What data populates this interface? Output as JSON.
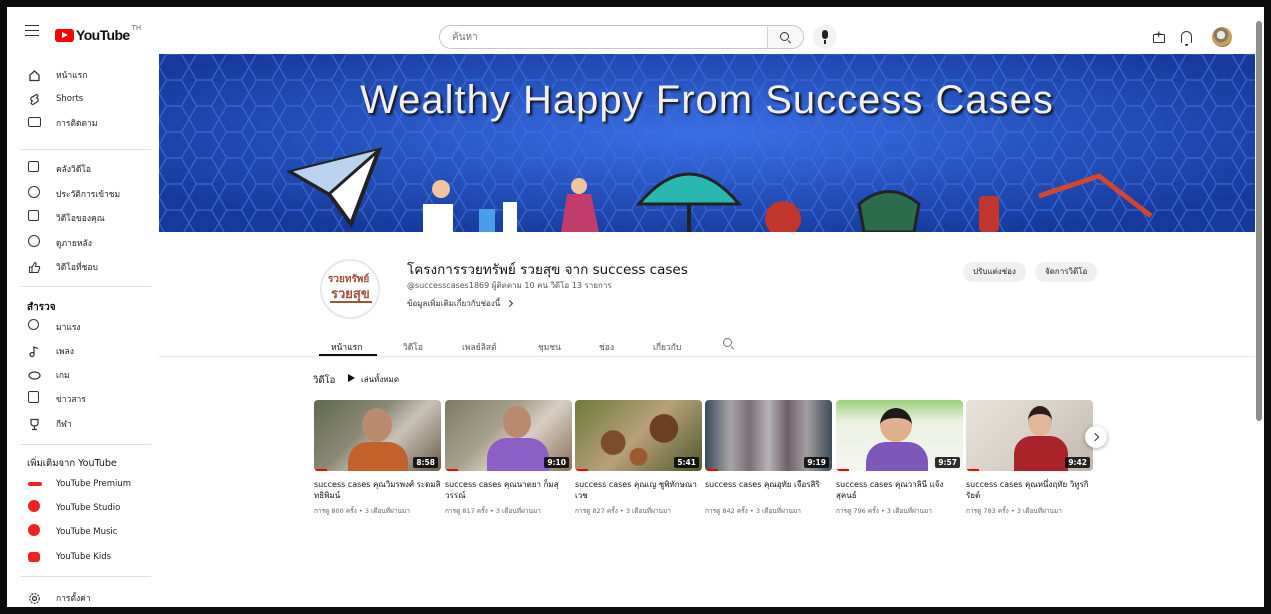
{
  "header": {
    "logo_text": "YouTube",
    "country_code": "TH",
    "search_placeholder": "ค้นหา",
    "icons": [
      "menu-icon",
      "search-icon",
      "mic-icon",
      "create-icon",
      "bell-icon",
      "avatar"
    ]
  },
  "sidebar": {
    "main": [
      {
        "label": "หน้าแรก",
        "icon": "home-icon"
      },
      {
        "label": "Shorts",
        "icon": "shorts-icon"
      },
      {
        "label": "การติดตาม",
        "icon": "subscriptions-icon"
      }
    ],
    "library": [
      {
        "label": "คลังวิดีโอ",
        "icon": "library-icon"
      },
      {
        "label": "ประวัติการเข้าชม",
        "icon": "history-icon"
      },
      {
        "label": "วิดีโอของคุณ",
        "icon": "your-videos-icon"
      },
      {
        "label": "ดูภายหลัง",
        "icon": "watch-later-icon"
      },
      {
        "label": "วิดีโอที่ชอบ",
        "icon": "liked-icon"
      }
    ],
    "explore_title": "สำรวจ",
    "explore": [
      {
        "label": "มาแรง",
        "icon": "trending-icon"
      },
      {
        "label": "เพลง",
        "icon": "music-icon"
      },
      {
        "label": "เกม",
        "icon": "gaming-icon"
      },
      {
        "label": "ข่าวสาร",
        "icon": "news-icon"
      },
      {
        "label": "กีฬา",
        "icon": "sports-icon"
      }
    ],
    "more_title": "เพิ่มเติมจาก YouTube",
    "more": [
      {
        "label": "YouTube Premium",
        "icon": "youtube-premium-icon"
      },
      {
        "label": "YouTube Studio",
        "icon": "youtube-studio-icon"
      },
      {
        "label": "YouTube Music",
        "icon": "youtube-music-icon"
      },
      {
        "label": "YouTube Kids",
        "icon": "youtube-kids-icon"
      }
    ],
    "settings_label": "การตั้งค่า"
  },
  "banner": {
    "text": "Wealthy Happy From Success Cases",
    "accent": "#1f49b8"
  },
  "channel": {
    "avatar_text_1": "รวยทรัพย์",
    "avatar_text_2": "รวยสุข",
    "title": "โครงการรวยทรัพย์ รวยสุข จาก success cases",
    "handle": "@successcases1869",
    "subscribers": "ผู้ติดตาม 10 คน",
    "video_count": "วิดีโอ 13 รายการ",
    "more_info": "ข้อมูลเพิ่มเติมเกี่ยวกับช่องนี้",
    "customize_button": "ปรับแต่งช่อง",
    "manage_button": "จัดการวิดีโอ"
  },
  "tabs": [
    "หน้าแรก",
    "วิดีโอ",
    "เพลย์ลิสต์",
    "ชุมชน",
    "ช่อง",
    "เกี่ยวกับ"
  ],
  "shelf": {
    "title": "วิดีโอ",
    "play_all": "เล่นทั้งหมด",
    "videos": [
      {
        "title": "success cases คุณวิมรพงศ์ ระดมสิทธิพิมน์",
        "duration": "8:58",
        "meta": "การดู 800 ครั้ง • 3 เดือนที่ผ่านมา",
        "progress": 0.1
      },
      {
        "title": "success cases คุณนาตยา ก็มสุวรรณ์",
        "duration": "9:10",
        "meta": "การดู 817 ครั้ง • 3 เดือนที่ผ่านมา",
        "progress": 0.1
      },
      {
        "title": "success cases คุณเญ ชูพิทักษณาเวช",
        "duration": "5:41",
        "meta": "การดู 827 ครั้ง • 3 เดือนที่ผ่านมา",
        "progress": 0.1
      },
      {
        "title": "success cases คุณอุทัย เจือรสิริ",
        "duration": "9:19",
        "meta": "การดู 842 ครั้ง • 3 เดือนที่ผ่านมา",
        "progress": 0.1
      },
      {
        "title": "success cases คุณวาลินี แจ้งสุคนธ์",
        "duration": "9:57",
        "meta": "การดู 796 ครั้ง • 3 เดือนที่ผ่านมา",
        "progress": 0.1
      },
      {
        "title": "success cases คุณหนึ่งฤทัย วิทูรกิรัยต์",
        "duration": "9:42",
        "meta": "การดู 783 ครั้ง • 3 เดือนที่ผ่านมา",
        "progress": 0.1
      }
    ]
  }
}
